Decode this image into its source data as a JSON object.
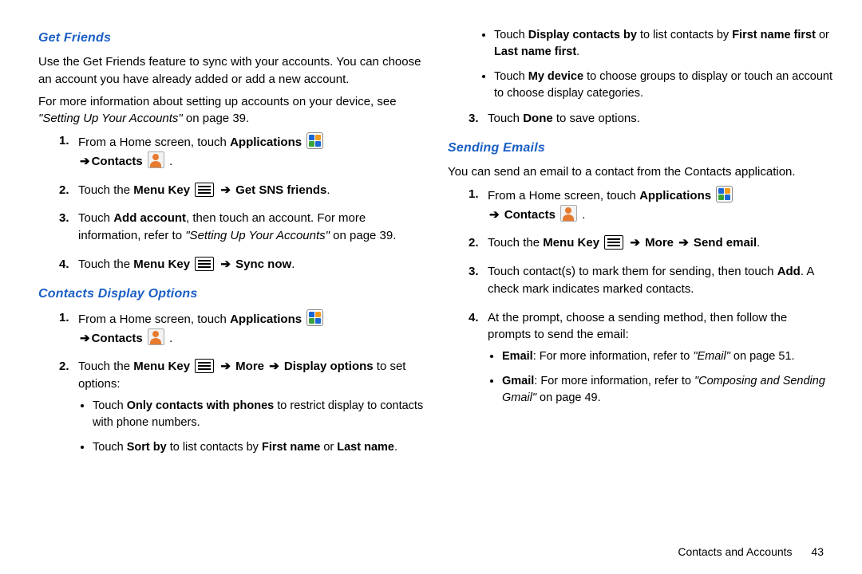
{
  "left": {
    "h1": "Get Friends",
    "p1": "Use the Get Friends feature to sync with your accounts. You can choose an account you have already added or add a new account.",
    "p2a": "For more information about setting up accounts on your device, see ",
    "p2ref": "\"Setting Up Your Accounts\"",
    "p2b": " on page 39.",
    "s1_a": "From a Home screen, touch ",
    "s1_apps": "Applications",
    "s1_contacts": "Contacts",
    "s2_a": "Touch the ",
    "s2_mk": "Menu Key",
    "s2_b": " Get SNS friends",
    "s3_a": "Touch ",
    "s3_add": "Add account",
    "s3_b": ", then touch an account. For more information, refer to ",
    "s3_ref": "\"Setting Up Your Accounts\"",
    "s3_c": " on page 39.",
    "s4_a": "Touch the ",
    "s4_mk": "Menu Key",
    "s4_b": " Sync now",
    "h2": "Contacts Display Options",
    "c1_a": "From a Home screen, touch ",
    "c1_apps": "Applications",
    "c1_contacts": "Contacts",
    "c2_a": "Touch the ",
    "c2_mk": "Menu Key",
    "c2_more": " More ",
    "c2_do": " Display options",
    "c2_b": " to set options:",
    "b1_a": "Touch ",
    "b1_b": "Only contacts with phones",
    "b1_c": " to restrict display to contacts with phone numbers.",
    "b2_a": "Touch ",
    "b2_b": "Sort by",
    "b2_c": " to list contacts by ",
    "b2_d": "First name",
    "b2_e": " or ",
    "b2_f": "Last name",
    "period": "."
  },
  "right": {
    "r1_a": "Touch ",
    "r1_b": "Display contacts by",
    "r1_c": " to list contacts by ",
    "r1_d": "First name first",
    "r1_e": " or ",
    "r1_f": "Last name first",
    "r2_a": "Touch ",
    "r2_b": "My device",
    "r2_c": " to choose groups to display or touch an account to choose display categories.",
    "r3_a": "Touch ",
    "r3_b": "Done",
    "r3_c": " to save options.",
    "h3": "Sending Emails",
    "p3": "You can send an email to a contact from the Contacts application.",
    "e1_a": "From a Home screen, touch ",
    "e1_apps": "Applications",
    "e1_contacts": " Contacts",
    "e2_a": "Touch the ",
    "e2_mk": "Menu Key",
    "e2_more": " More ",
    "e2_send": " Send email",
    "e3_a": "Touch contact(s) to mark them for sending, then touch ",
    "e3_add": "Add",
    "e3_b": ". A check mark indicates marked contacts.",
    "e4": "At the prompt, choose a sending method, then follow the prompts to send the email:",
    "sb1_a": "Email",
    "sb1_b": ": For more information, refer to ",
    "sb1_ref": "\"Email\"",
    "sb1_c": "  on page 51.",
    "sb2_a": "Gmail",
    "sb2_b": ": For more information, refer to ",
    "sb2_ref": "\"Composing and Sending Gmail\"",
    "sb2_c": "  on page 49."
  },
  "footer": {
    "section": "Contacts and Accounts",
    "page": "43"
  },
  "arrow": "➔"
}
